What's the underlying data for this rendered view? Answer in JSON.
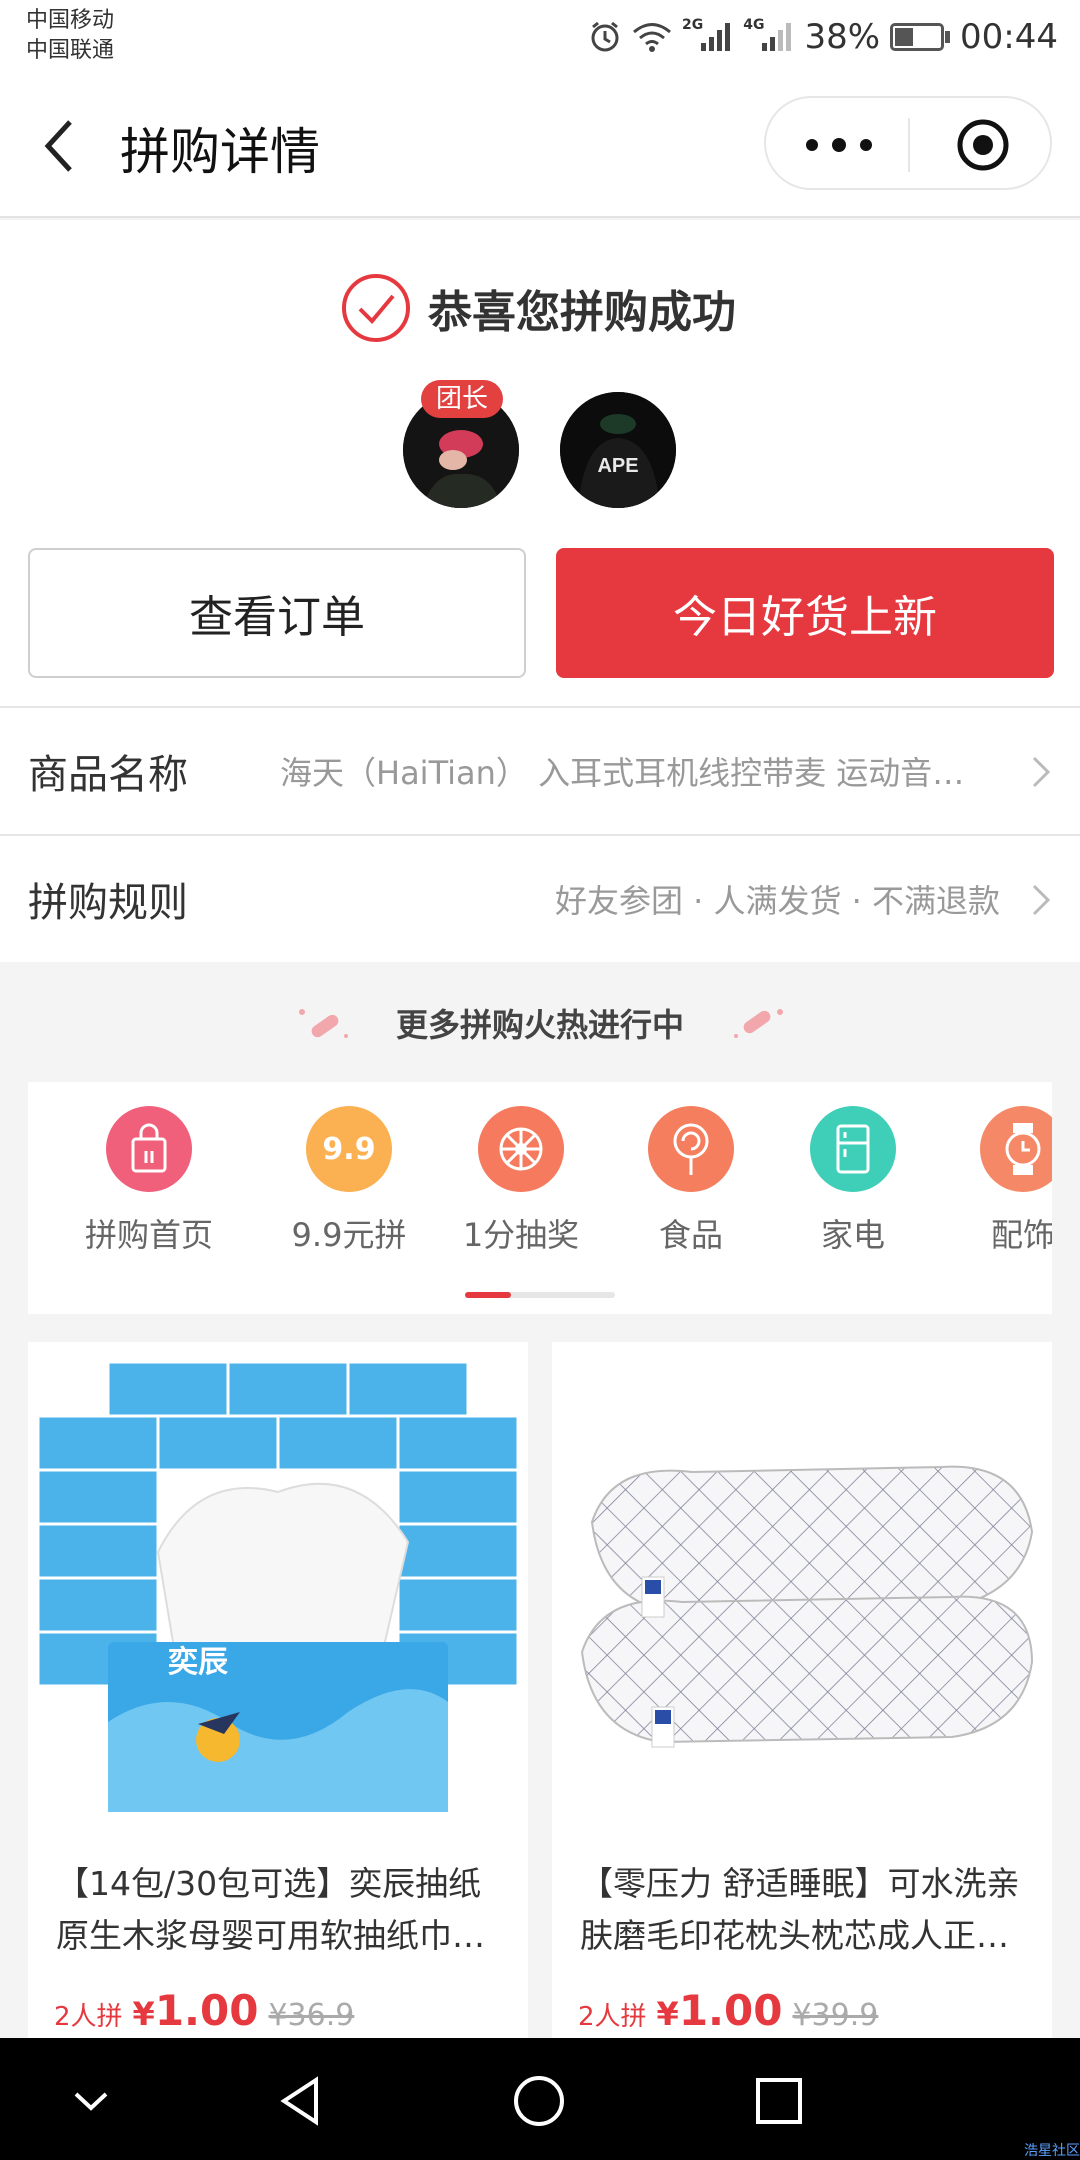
{
  "status_bar": {
    "carrier1": "中国移动",
    "carrier2": "中国联通",
    "net1": "2G",
    "net2": "4G",
    "battery": "38%",
    "time": "00:44"
  },
  "header": {
    "title": "拼购详情"
  },
  "success": {
    "title": "恭喜您拼购成功",
    "leader_badge": "团长",
    "avatar_text": "APE",
    "view_order": "查看订单",
    "today_new": "今日好货上新",
    "product_label": "商品名称",
    "product_value": "海天（HaiTian） 入耳式耳机线控带麦 运动音…",
    "rules_label": "拼购规则",
    "rules_value": "好友参团 · 人满发货 · 不满退款"
  },
  "more_section": {
    "heading": "更多拼购火热进行中"
  },
  "categories": [
    {
      "label": "拼购首页",
      "icon": "shopping-bag-icon",
      "color": "#f0607a"
    },
    {
      "label": "9.9元拼",
      "icon": "9.9",
      "color": "#fbb152"
    },
    {
      "label": "1分抽奖",
      "icon": "wheel-icon",
      "color": "#f57a5e"
    },
    {
      "label": "食品",
      "icon": "lollipop-icon",
      "color": "#f47e5e"
    },
    {
      "label": "家电",
      "icon": "fridge-icon",
      "color": "#3fcfb8"
    },
    {
      "label": "配饰",
      "icon": "watch-icon",
      "color": "#f58866"
    }
  ],
  "products": [
    {
      "title_line1": "【14包/30包可选】奕辰抽纸",
      "title_line2": "原生木浆母婴可用软抽纸巾…",
      "count": "2人拼",
      "currency": "¥",
      "price": "1.00",
      "orig": "¥36.9",
      "brand": "奕辰"
    },
    {
      "title_line1": "【零压力 舒适睡眠】可水洗亲",
      "title_line2": "肤磨毛印花枕头枕芯成人正…",
      "count": "2人拼",
      "currency": "¥",
      "price": "1.00",
      "orig": "¥39.9"
    }
  ],
  "watermark": "浩星社区"
}
